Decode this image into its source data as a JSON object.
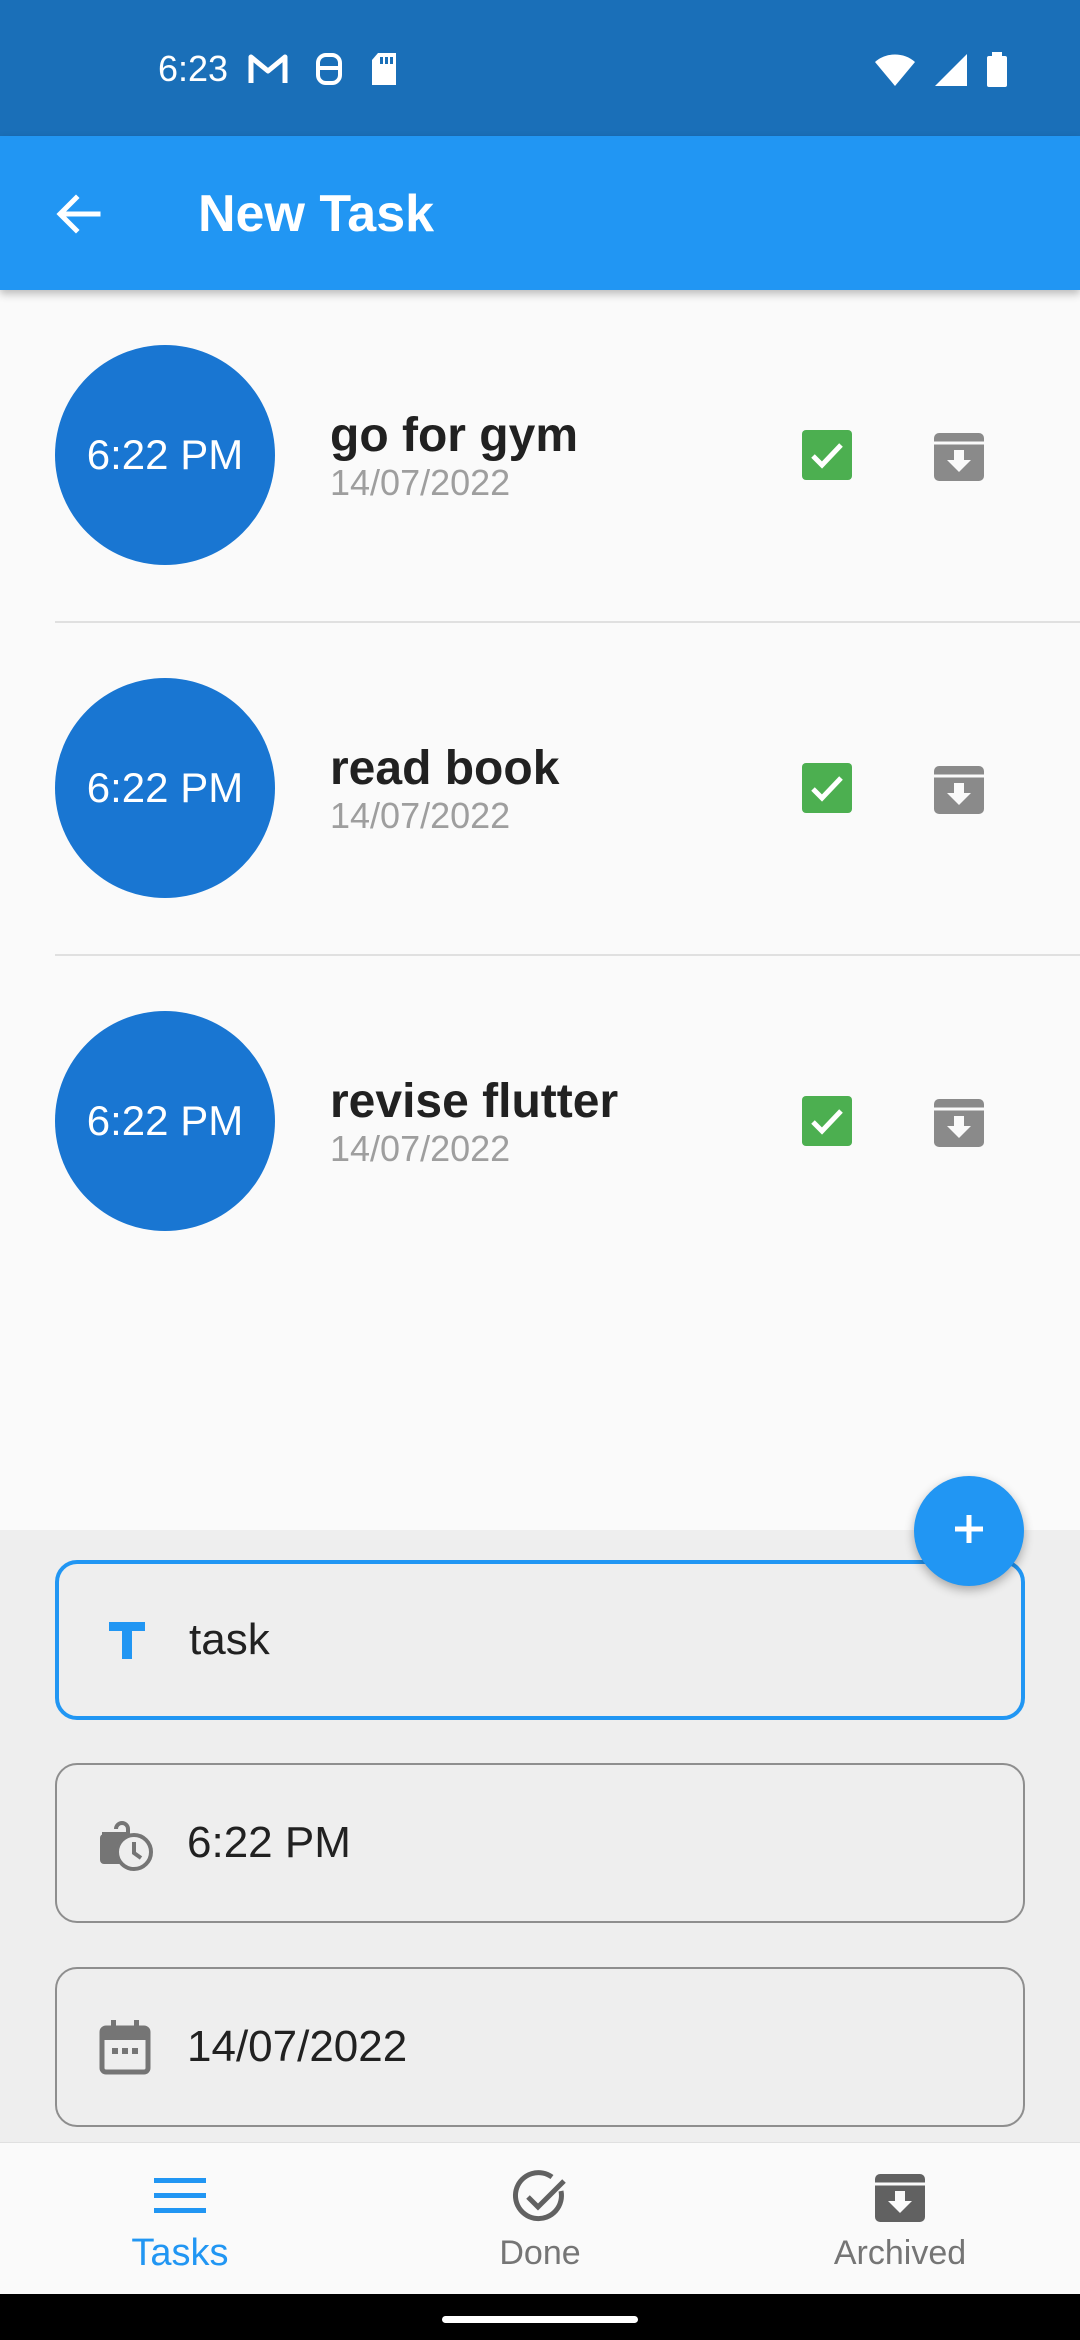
{
  "status_bar": {
    "time": "6:23",
    "left_icons": [
      "gmail-icon",
      "accessibility-icon",
      "sd-card-icon"
    ],
    "right_icons": [
      "wifi-icon",
      "signal-icon",
      "battery-icon"
    ]
  },
  "app_bar": {
    "title": "New Task",
    "back_icon": "arrow-back-icon",
    "color": "#2196f3"
  },
  "tasks": [
    {
      "time": "6:22 PM",
      "title": "go for gym",
      "date": "14/07/2022"
    },
    {
      "time": "6:22 PM",
      "title": "read book",
      "date": "14/07/2022"
    },
    {
      "time": "6:22 PM",
      "title": "revise flutter",
      "date": "14/07/2022"
    }
  ],
  "form": {
    "title_field": {
      "value": "task",
      "icon": "title-icon"
    },
    "time_field": {
      "value": "6:22 PM",
      "icon": "clock-icon"
    },
    "date_field": {
      "value": "14/07/2022",
      "icon": "calendar-icon"
    }
  },
  "fab": {
    "icon": "add-icon"
  },
  "bottom_nav": {
    "items": [
      {
        "label": "Tasks",
        "icon": "menu-icon",
        "active": true
      },
      {
        "label": "Done",
        "icon": "check-circle-icon",
        "active": false
      },
      {
        "label": "Archived",
        "icon": "archive-icon",
        "active": false
      }
    ]
  },
  "colors": {
    "primary": "#2196f3",
    "status_bar": "#1a6fb8",
    "time_circle": "#1976d2",
    "done_green": "#4caf50",
    "archive_grey": "#8a8a8a"
  }
}
